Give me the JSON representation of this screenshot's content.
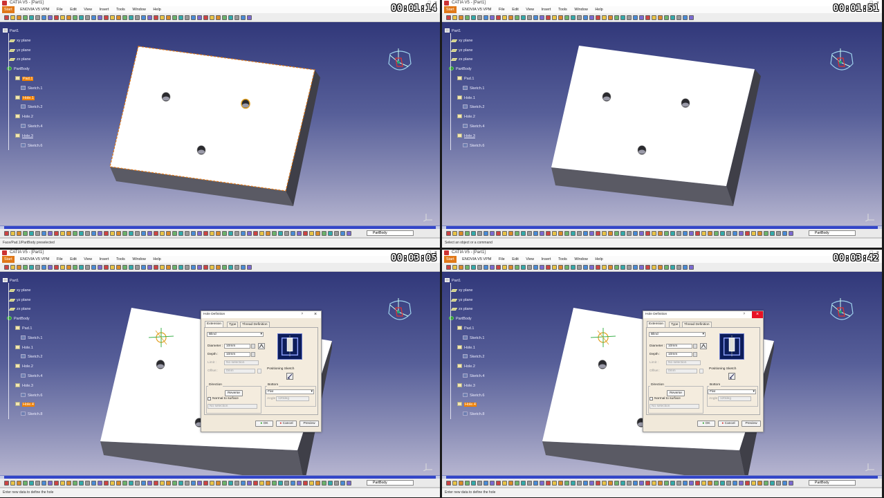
{
  "window": {
    "title": "CATIA V5 - [Part1]",
    "controls": [
      "_",
      "□",
      "×"
    ]
  },
  "menu": [
    "Start",
    "ENOVIA V5 VPM",
    "File",
    "Edit",
    "View",
    "Insert",
    "Tools",
    "Window",
    "Help"
  ],
  "workbench_select": "PartBody",
  "tree": {
    "part": "Part1",
    "planes": [
      "xy plane",
      "yz plane",
      "zx plane"
    ],
    "body": "PartBody"
  },
  "panels": [
    {
      "timer": "00:01:14",
      "status": "Face/Pad.1/PartBody preselected",
      "features": [
        {
          "label": "Pad.1",
          "type": "feat",
          "highlight": true
        },
        {
          "label": "Sketch.1",
          "type": "sk"
        },
        {
          "label": "Hole.1",
          "type": "feat",
          "highlight": true
        },
        {
          "label": "Sketch.2",
          "type": "sk"
        },
        {
          "label": "Hole.2",
          "type": "feat"
        },
        {
          "label": "Sketch.4",
          "type": "sk"
        },
        {
          "label": "Hole.3",
          "type": "feat",
          "underline": true
        },
        {
          "label": "Sketch.6",
          "type": "sk"
        }
      ]
    },
    {
      "timer": "00:01:51",
      "status": "Select an object or a command",
      "features": [
        {
          "label": "Pad.1",
          "type": "feat"
        },
        {
          "label": "Sketch.1",
          "type": "sk"
        },
        {
          "label": "Hole.1",
          "type": "feat"
        },
        {
          "label": "Sketch.2",
          "type": "sk"
        },
        {
          "label": "Hole.2",
          "type": "feat"
        },
        {
          "label": "Sketch.4",
          "type": "sk"
        },
        {
          "label": "Hole.3",
          "type": "feat",
          "underline": true
        },
        {
          "label": "Sketch.6",
          "type": "sk"
        }
      ]
    },
    {
      "timer": "00:03:05",
      "status": "Enter new data to define the hole",
      "features": [
        {
          "label": "Pad.1",
          "type": "feat"
        },
        {
          "label": "Sketch.1",
          "type": "sk"
        },
        {
          "label": "Hole.1",
          "type": "feat"
        },
        {
          "label": "Sketch.2",
          "type": "sk"
        },
        {
          "label": "Hole.2",
          "type": "feat"
        },
        {
          "label": "Sketch.4",
          "type": "sk"
        },
        {
          "label": "Hole.3",
          "type": "feat"
        },
        {
          "label": "Sketch.6",
          "type": "sk"
        },
        {
          "label": "Hole.4",
          "type": "feat",
          "highlight": true
        },
        {
          "label": "Sketch.8",
          "type": "sk"
        }
      ]
    },
    {
      "timer": "00:03:42",
      "status": "Enter new data to define the hole",
      "features": [
        {
          "label": "Pad.1",
          "type": "feat"
        },
        {
          "label": "Sketch.1",
          "type": "sk"
        },
        {
          "label": "Hole.1",
          "type": "feat"
        },
        {
          "label": "Sketch.2",
          "type": "sk"
        },
        {
          "label": "Hole.2",
          "type": "feat"
        },
        {
          "label": "Sketch.4",
          "type": "sk"
        },
        {
          "label": "Hole.3",
          "type": "feat"
        },
        {
          "label": "Sketch.6",
          "type": "sk"
        },
        {
          "label": "Hole.4",
          "type": "feat",
          "highlight": true
        },
        {
          "label": "Sketch.8",
          "type": "sk"
        }
      ]
    }
  ],
  "dialog": {
    "title": "Hole Definition",
    "help": "?",
    "close": "×",
    "tabs": [
      "Extension",
      "Type",
      "Thread Definition"
    ],
    "extension_type": "Blind",
    "diameter_label": "Diameter :",
    "diameter": "10mm",
    "depth_label": "Depth :",
    "depth": "10mm",
    "limit_label": "Limit :",
    "limit_value": "No selection",
    "offset_label": "Offset :",
    "offset_value": "0mm",
    "positioning_sketch": "Positioning Sketch",
    "direction_label": "Direction",
    "reverse": "Reverse",
    "normal_to_surface": "Normal to surface",
    "direction_selection": "No selection",
    "bottom_label": "Bottom",
    "bottom_type": "Flat",
    "angle_label": "Angle :",
    "angle_value": "120deg",
    "ok": "OK",
    "cancel": "Cancel",
    "preview": "Preview"
  },
  "colors": {
    "viewport_top": "#31387a",
    "viewport_bottom": "#b6b5d0",
    "selection_orange": "#f08000",
    "scrollbar_blue": "#3346c8"
  }
}
